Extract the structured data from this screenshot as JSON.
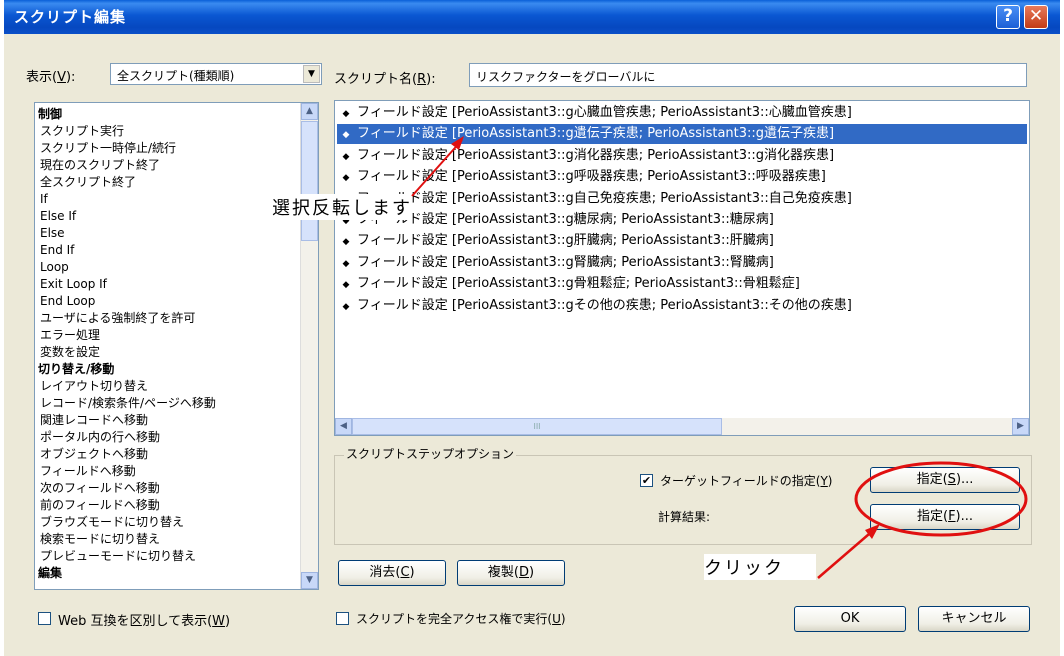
{
  "window": {
    "title": "スクリプト編集",
    "help_btn": "?",
    "close_btn": "✕"
  },
  "view": {
    "label_pre": "表示(",
    "label_key": "V",
    "label_post": "):",
    "value": "全スクリプト(種類順)"
  },
  "script_name": {
    "label_pre": "スクリプト名(",
    "label_key": "R",
    "label_post": "):",
    "value": "リスクファクターをグローバルに"
  },
  "steps": [
    {
      "label": "制御",
      "cat": true
    },
    {
      "label": "スクリプト実行"
    },
    {
      "label": "スクリプト一時停止/続行"
    },
    {
      "label": "現在のスクリプト終了"
    },
    {
      "label": "全スクリプト終了"
    },
    {
      "label": "If"
    },
    {
      "label": "Else If"
    },
    {
      "label": "Else"
    },
    {
      "label": "End If"
    },
    {
      "label": "Loop"
    },
    {
      "label": "Exit Loop If"
    },
    {
      "label": "End Loop"
    },
    {
      "label": "ユーザによる強制終了を許可"
    },
    {
      "label": "エラー処理"
    },
    {
      "label": "変数を設定"
    },
    {
      "label": "切り替え/移動",
      "cat": true
    },
    {
      "label": "レイアウト切り替え"
    },
    {
      "label": "レコード/検索条件/ページへ移動"
    },
    {
      "label": "関連レコードへ移動"
    },
    {
      "label": "ポータル内の行へ移動"
    },
    {
      "label": "オブジェクトへ移動"
    },
    {
      "label": "フィールドへ移動"
    },
    {
      "label": "次のフィールドへ移動"
    },
    {
      "label": "前のフィールドへ移動"
    },
    {
      "label": "ブラウズモードに切り替え"
    },
    {
      "label": "検索モードに切り替え"
    },
    {
      "label": "プレビューモードに切り替え"
    },
    {
      "label": "編集",
      "cat": true
    }
  ],
  "script_lines": [
    {
      "text": "フィールド設定 [PerioAssistant3::g心臓血管疾患; PerioAssistant3::心臓血管疾患]"
    },
    {
      "text": "フィールド設定 [PerioAssistant3::g遺伝子疾患; PerioAssistant3::g遺伝子疾患]",
      "selected": true
    },
    {
      "text": "フィールド設定 [PerioAssistant3::g消化器疾患; PerioAssistant3::g消化器疾患]"
    },
    {
      "text": "フィールド設定 [PerioAssistant3::g呼吸器疾患; PerioAssistant3::呼吸器疾患]"
    },
    {
      "text": "フィールド設定 [PerioAssistant3::g自己免疫疾患; PerioAssistant3::自己免疫疾患]"
    },
    {
      "text": "フィールド設定 [PerioAssistant3::g糖尿病; PerioAssistant3::糖尿病]"
    },
    {
      "text": "フィールド設定 [PerioAssistant3::g肝臓病; PerioAssistant3::肝臓病]"
    },
    {
      "text": "フィールド設定 [PerioAssistant3::g腎臓病; PerioAssistant3::腎臓病]"
    },
    {
      "text": "フィールド設定 [PerioAssistant3::g骨粗鬆症; PerioAssistant3::骨粗鬆症]"
    },
    {
      "text": "フィールド設定 [PerioAssistant3::gその他の疾患; PerioAssistant3::その他の疾患]"
    }
  ],
  "options": {
    "group_title": "スクリプトステップオプション",
    "target_field": {
      "pre": "ターゲットフィールドの指定(",
      "key": "Y",
      "post": ")",
      "checked": true,
      "mark": "✔"
    },
    "specify_s": {
      "pre": "指定(",
      "key": "S",
      "post": ")..."
    },
    "calc_label": "計算結果:",
    "specify_f": {
      "pre": "指定(",
      "key": "F",
      "post": ")..."
    }
  },
  "buttons": {
    "clear": {
      "pre": "消去(",
      "key": "C",
      "post": ")"
    },
    "duplicate": {
      "pre": "複製(",
      "key": "D",
      "post": ")"
    },
    "ok": "OK",
    "cancel": "キャンセル"
  },
  "checkboxes": {
    "web_compat": {
      "pre": "Web 互換を区別して表示(",
      "key": "W",
      "post": ")"
    },
    "full_access": {
      "pre": "スクリプトを完全アクセス権で実行(",
      "key": "U",
      "post": ")"
    }
  },
  "annotations": {
    "invert": "選択反転します",
    "click": "クリック"
  },
  "colors": {
    "selection": "#316ac5",
    "annotation_red": "#e01010",
    "title_blue": "#0a57d2"
  }
}
